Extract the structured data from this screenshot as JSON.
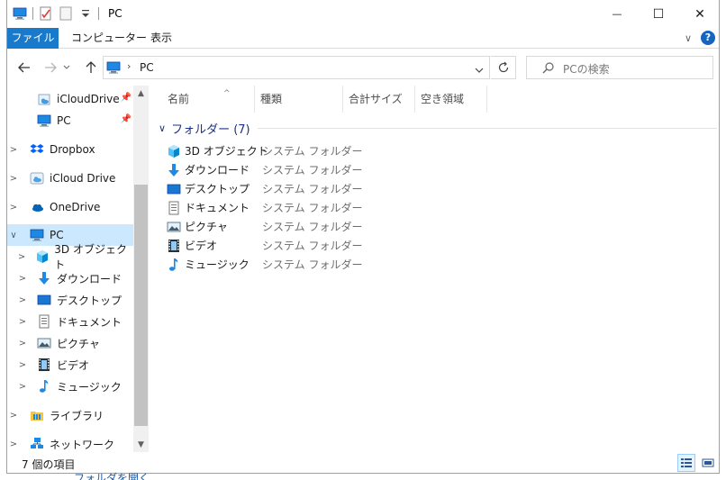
{
  "window": {
    "title": "PC",
    "minimize_glyph": "—",
    "maximize_glyph": "☐",
    "close_glyph": "✕"
  },
  "ribbon": {
    "tabs": [
      "ファイル",
      "コンピューター",
      "表示"
    ],
    "expand_glyph": "∨",
    "help_glyph": "?"
  },
  "address": {
    "path": "PC",
    "search_placeholder": "PCの検索"
  },
  "nav": {
    "quick_access": [
      {
        "label": "iCloudDrive",
        "icon": "icloud-drive-icon",
        "pinned": true
      },
      {
        "label": "PC",
        "icon": "pc-icon",
        "pinned": true
      }
    ],
    "roots": [
      {
        "label": "Dropbox",
        "icon": "dropbox-icon"
      },
      {
        "label": "iCloud Drive",
        "icon": "icloud-icon"
      },
      {
        "label": "OneDrive",
        "icon": "onedrive-icon"
      },
      {
        "label": "PC",
        "icon": "pc-icon",
        "selected": true,
        "expanded": true
      }
    ],
    "pc_children": [
      {
        "label": "3D オブジェクト",
        "icon": "3d-objects-icon"
      },
      {
        "label": "ダウンロード",
        "icon": "downloads-icon"
      },
      {
        "label": "デスクトップ",
        "icon": "desktop-icon"
      },
      {
        "label": "ドキュメント",
        "icon": "documents-icon"
      },
      {
        "label": "ピクチャ",
        "icon": "pictures-icon"
      },
      {
        "label": "ビデオ",
        "icon": "videos-icon"
      },
      {
        "label": "ミュージック",
        "icon": "music-icon"
      }
    ],
    "after": [
      {
        "label": "ライブラリ",
        "icon": "libraries-icon"
      },
      {
        "label": "ネットワーク",
        "icon": "network-icon"
      }
    ]
  },
  "content": {
    "columns": [
      "名前",
      "種類",
      "合計サイズ",
      "空き領域"
    ],
    "group_label": "フォルダー (7)",
    "items": [
      {
        "name": "3D オブジェクト",
        "type": "システム フォルダー",
        "icon": "3d-objects-icon"
      },
      {
        "name": "ダウンロード",
        "type": "システム フォルダー",
        "icon": "downloads-icon"
      },
      {
        "name": "デスクトップ",
        "type": "システム フォルダー",
        "icon": "desktop-icon"
      },
      {
        "name": "ドキュメント",
        "type": "システム フォルダー",
        "icon": "documents-icon"
      },
      {
        "name": "ピクチャ",
        "type": "システム フォルダー",
        "icon": "pictures-icon"
      },
      {
        "name": "ビデオ",
        "type": "システム フォルダー",
        "icon": "videos-icon"
      },
      {
        "name": "ミュージック",
        "type": "システム フォルダー",
        "icon": "music-icon"
      }
    ]
  },
  "status": {
    "item_count": "7 個の項目"
  },
  "behind_window_text": "フォルダを開く",
  "colors": {
    "accent": "#1979ca",
    "selection": "#cce8ff",
    "group_header": "#1e3287"
  }
}
